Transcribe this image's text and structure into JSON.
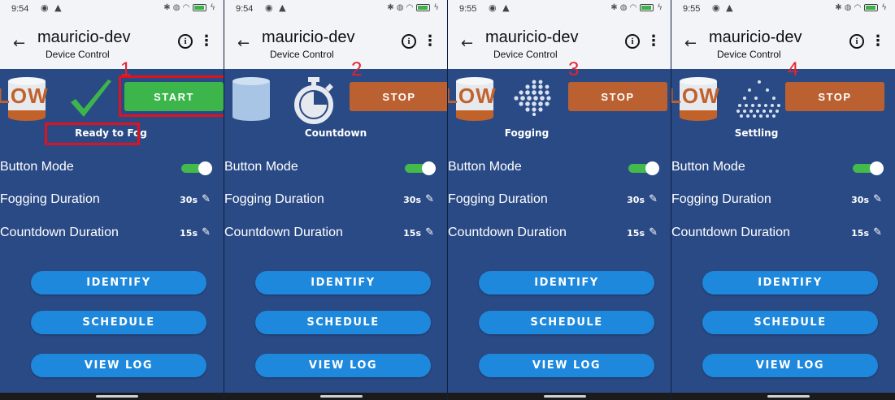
{
  "colors": {
    "panel_bg": "#2a4a86",
    "start": "#3cb54a",
    "stop": "#bb6131",
    "menu_button": "#1e88dd",
    "toggle_on": "#44b94c",
    "step_number": "#e4232b",
    "highlight": "#e0121d"
  },
  "app": {
    "title": "mauricio-dev",
    "subtitle": "Device Control",
    "back_icon": "back-arrow-icon",
    "info_icon": "info-icon",
    "more_icon": "more-vert-icon"
  },
  "settings": {
    "button_mode_label": "Button Mode",
    "button_mode_on": true,
    "fog_label": "Fogging Duration",
    "fog_value": "30s",
    "countdown_label": "Countdown Duration",
    "countdown_value": "15s"
  },
  "menu": {
    "identify": "IDENTIFY",
    "schedule": "SCHEDULE",
    "view_log": "VIEW LOG"
  },
  "panels": [
    {
      "step": "1",
      "time": "9:54",
      "tank_level": "LOW",
      "state_icon": "checkmark-icon",
      "action": "START",
      "status": "Ready to Fog"
    },
    {
      "step": "2",
      "time": "9:54",
      "tank_level": "",
      "state_icon": "stopwatch-icon",
      "action": "STOP",
      "status": "Countdown"
    },
    {
      "step": "3",
      "time": "9:55",
      "tank_level": "LOW",
      "state_icon": "fog-dense-icon",
      "action": "STOP",
      "status": "Fogging"
    },
    {
      "step": "4",
      "time": "9:55",
      "tank_level": "LOW",
      "state_icon": "fog-sparse-icon",
      "action": "STOP",
      "status": "Settling"
    }
  ]
}
